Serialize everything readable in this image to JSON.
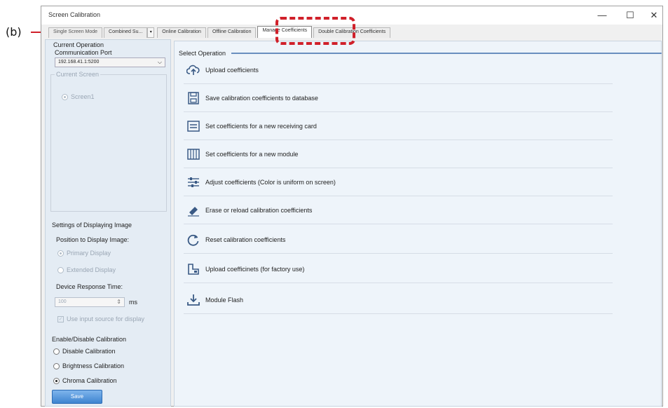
{
  "annotation": {
    "label": "(b)"
  },
  "window": {
    "title": "Screen Calibration",
    "min": "—",
    "max": "☐",
    "close": "✕"
  },
  "tabs": [
    {
      "label": "Single Screen Mode"
    },
    {
      "label": "Combined Su...",
      "arrow": "▾"
    },
    {
      "label": "Online Calibration"
    },
    {
      "label": "Offline Calibration"
    },
    {
      "label": "Manage Coefficients"
    },
    {
      "label": "Double Calibration Coefficients"
    }
  ],
  "left": {
    "current_operation": "Current Operation",
    "comm_port_label": "Communication Port",
    "comm_port_value": "192.168.41.1:5200",
    "current_screen_label": "Current Screen",
    "screen_item": "Screen1",
    "display_settings_title": "Settings of Displaying Image",
    "position_label": "Position to Display Image:",
    "primary_display": "Primary Display",
    "extended_display": "Extended Display",
    "response_time_label": "Device Response Time:",
    "response_time_value": "100",
    "response_time_unit": "ms",
    "use_input_source": "Use input source for display",
    "enable_title": "Enable/Disable Calibration",
    "disable_calibration": "Disable Calibration",
    "brightness_calibration": "Brightness Calibration",
    "chroma_calibration": "Chroma Calibration",
    "save_button": "Save"
  },
  "right": {
    "select_operation": "Select Operation",
    "operations": [
      {
        "label": "Upload coefficients",
        "icon": "cloud-upload-icon"
      },
      {
        "label": "Save calibration coefficients to database",
        "icon": "save-icon"
      },
      {
        "label": "Set coefficients for a new receiving card",
        "icon": "receiving-card-icon"
      },
      {
        "label": "Set coefficients for a new module",
        "icon": "module-icon"
      },
      {
        "label": "Adjust coefficients (Color is uniform on screen)",
        "icon": "sliders-icon"
      },
      {
        "label": "Erase or reload calibration coefficients",
        "icon": "eraser-icon"
      },
      {
        "label": "Reset calibration coefficients",
        "icon": "reset-icon"
      },
      {
        "label": "Upload coefficinets (for factory use)",
        "icon": "factory-upload-icon"
      },
      {
        "label": "Module Flash",
        "icon": "download-icon"
      }
    ]
  },
  "colors": {
    "annotation": "#d0202a",
    "accent": "#2b6bb5",
    "icon": "#3a5a85"
  }
}
